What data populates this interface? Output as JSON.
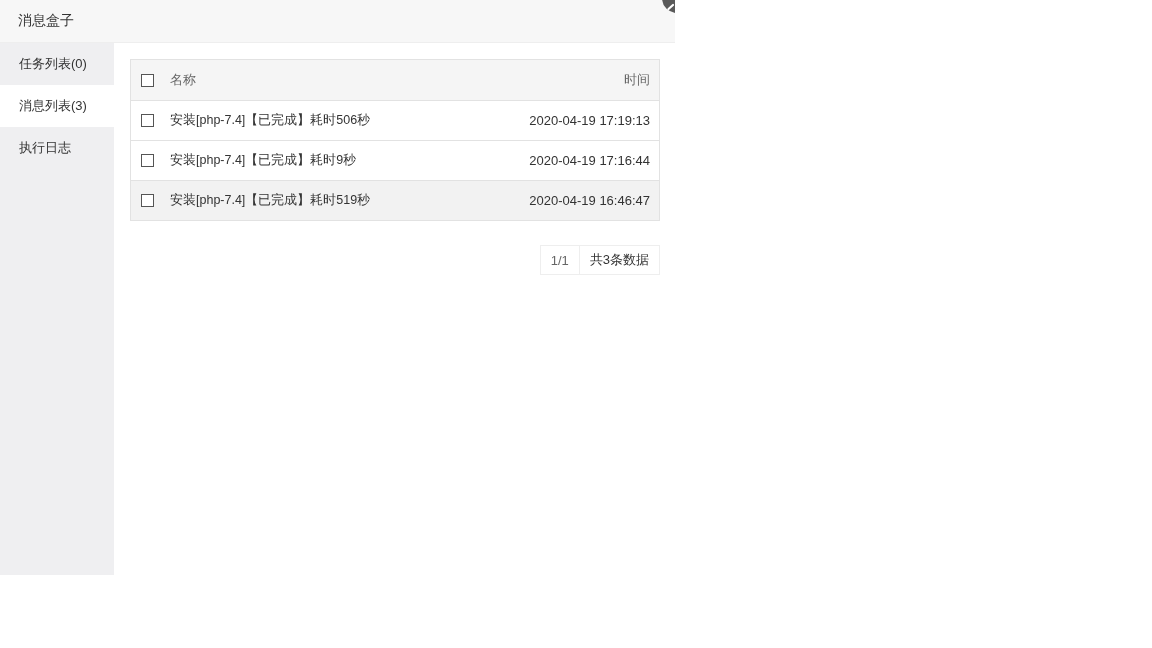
{
  "dialog": {
    "title": "消息盒子"
  },
  "sidebar": {
    "items": [
      {
        "label": "任务列表(0)",
        "selected": false
      },
      {
        "label": "消息列表(3)",
        "selected": true
      },
      {
        "label": "执行日志",
        "selected": false
      }
    ]
  },
  "table": {
    "header_checkbox": {
      "checked": false
    },
    "columns": [
      "名称",
      "时间"
    ],
    "rows": [
      {
        "name": "安装[php-7.4]【已完成】耗时506秒",
        "time": "2020-04-19 17:19:13",
        "checked": false,
        "hovered": false
      },
      {
        "name": "安装[php-7.4]【已完成】耗时9秒",
        "time": "2020-04-19 17:16:44",
        "checked": false,
        "hovered": false
      },
      {
        "name": "安装[php-7.4]【已完成】耗时519秒",
        "time": "2020-04-19 16:46:47",
        "checked": false,
        "hovered": true
      }
    ]
  },
  "pagination": {
    "page": "1/1",
    "total": "共3条数据"
  }
}
